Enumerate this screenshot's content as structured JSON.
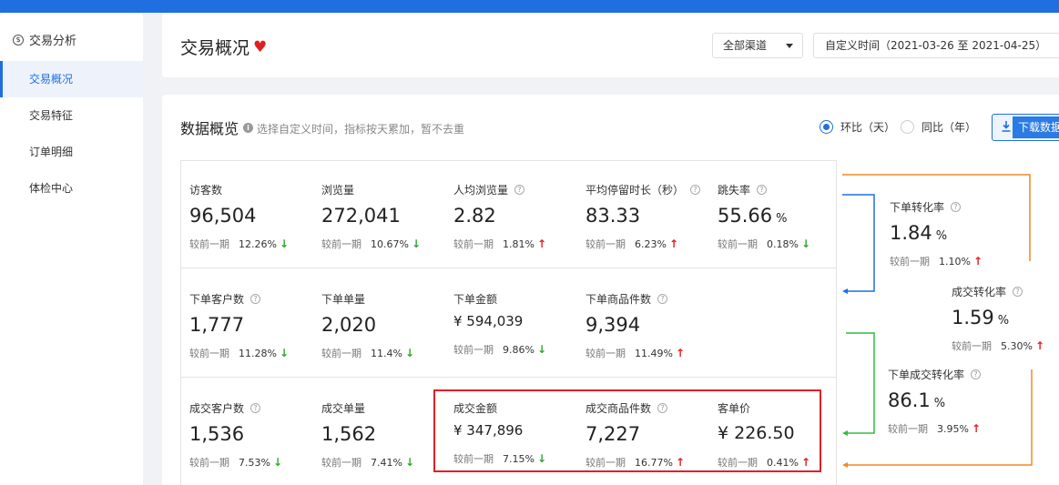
{
  "sidebar": {
    "header": "交易分析",
    "items": [
      {
        "label": "交易概况",
        "active": true
      },
      {
        "label": "交易特征",
        "active": false
      },
      {
        "label": "订单明细",
        "active": false
      },
      {
        "label": "体检中心",
        "active": false
      }
    ]
  },
  "header": {
    "title": "交易概况",
    "channel": "全部渠道",
    "date_range": "自定义时间（2021-03-26 至 2021-04-25）"
  },
  "overview": {
    "title": "数据概览",
    "hint": "选择自定义时间，指标按天累加，暂不去重",
    "compare_options": [
      {
        "label": "环比（天）",
        "selected": true
      },
      {
        "label": "同比（年）",
        "selected": false
      }
    ],
    "download_label": "下载数据",
    "compare_prefix": "较前一期",
    "metrics": {
      "visitors": {
        "label": "访客数",
        "value": "96,504",
        "pct": "12.26%",
        "dir": "down"
      },
      "pageviews": {
        "label": "浏览量",
        "value": "272,041",
        "pct": "10.67%",
        "dir": "down"
      },
      "avg_pv": {
        "label": "人均浏览量",
        "value": "2.82",
        "pct": "1.81%",
        "dir": "up"
      },
      "avg_stay": {
        "label": "平均停留时长（秒）",
        "value": "83.33",
        "pct": "6.23%",
        "dir": "up"
      },
      "bounce": {
        "label": "跳失率",
        "value": "55.66",
        "unit": "%",
        "pct": "0.18%",
        "dir": "down"
      },
      "order_customers": {
        "label": "下单客户数",
        "value": "1,777",
        "pct": "11.28%",
        "dir": "down"
      },
      "order_count": {
        "label": "下单单量",
        "value": "2,020",
        "pct": "11.4%",
        "dir": "down"
      },
      "order_amount": {
        "label": "下单金额",
        "value": "¥ 594,039",
        "pct": "9.86%",
        "dir": "down"
      },
      "order_items": {
        "label": "下单商品件数",
        "value": "9,394",
        "pct": "11.49%",
        "dir": "up"
      },
      "deal_customers": {
        "label": "成交客户数",
        "value": "1,536",
        "pct": "7.53%",
        "dir": "down"
      },
      "deal_count": {
        "label": "成交单量",
        "value": "1,562",
        "pct": "7.41%",
        "dir": "down"
      },
      "deal_amount": {
        "label": "成交金额",
        "value": "¥ 347,896",
        "pct": "7.15%",
        "dir": "down"
      },
      "deal_items": {
        "label": "成交商品件数",
        "value": "7,227",
        "pct": "16.77%",
        "dir": "up"
      },
      "avg_price": {
        "label": "客单价",
        "value": "¥ 226.50",
        "pct": "0.41%",
        "dir": "up"
      },
      "order_conv": {
        "label": "下单转化率",
        "value": "1.84",
        "unit": "%",
        "pct": "1.10%",
        "dir": "up"
      },
      "deal_conv": {
        "label": "成交转化率",
        "value": "1.59",
        "unit": "%",
        "pct": "5.30%",
        "dir": "up"
      },
      "order_deal_conv": {
        "label": "下单成交转化率",
        "value": "86.1",
        "unit": "%",
        "pct": "3.95%",
        "dir": "up"
      }
    }
  },
  "colors": {
    "accent": "#1f6fe0",
    "up": "#e0201f",
    "down": "#2ea82e",
    "flow_orange": "#f08a24",
    "flow_blue": "#1f6fe0",
    "flow_green": "#2ebd40",
    "highlight": "#e21f26"
  }
}
